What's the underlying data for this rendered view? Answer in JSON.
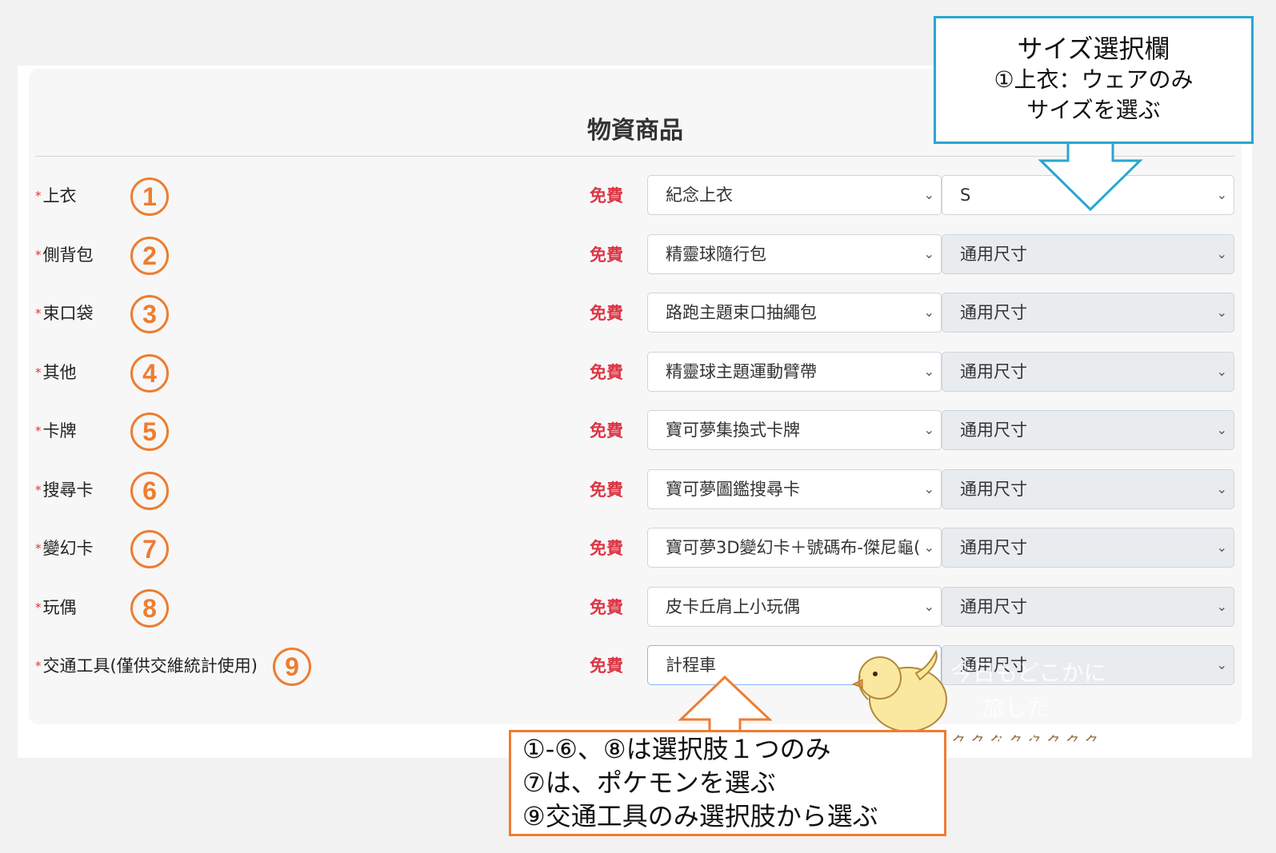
{
  "card": {
    "title": "物資商品"
  },
  "free_label": "免費",
  "rows": [
    {
      "label": "上衣",
      "number": "1",
      "item": "紀念上衣",
      "size": "S",
      "size_disabled": false
    },
    {
      "label": "側背包",
      "number": "2",
      "item": "精靈球隨行包",
      "size": "通用尺寸",
      "size_disabled": true
    },
    {
      "label": "束口袋",
      "number": "3",
      "item": "路跑主題束口抽繩包",
      "size": "通用尺寸",
      "size_disabled": true
    },
    {
      "label": "其他",
      "number": "4",
      "item": "精靈球主題運動臂帶",
      "size": "通用尺寸",
      "size_disabled": true
    },
    {
      "label": "卡牌",
      "number": "5",
      "item": "寶可夢集換式卡牌",
      "size": "通用尺寸",
      "size_disabled": true
    },
    {
      "label": "搜尋卡",
      "number": "6",
      "item": "寶可夢圖鑑搜尋卡",
      "size": "通用尺寸",
      "size_disabled": true
    },
    {
      "label": "變幻卡",
      "number": "7",
      "item": "寶可夢3D變幻卡＋號碼布-傑尼龜(",
      "size": "通用尺寸",
      "size_disabled": true
    },
    {
      "label": "玩偶",
      "number": "8",
      "item": "皮卡丘肩上小玩偶",
      "size": "通用尺寸",
      "size_disabled": true
    },
    {
      "label": "交通工具(僅供交維統計使用)",
      "number": "9",
      "item": "計程車",
      "size": "通用尺寸",
      "size_disabled": true
    }
  ],
  "required_mark": "*",
  "size_callout": {
    "line1": "サイズ選択欄",
    "line2": "①上衣：ウェアのみ",
    "line3": "サイズを選ぶ"
  },
  "note_callout": {
    "line1": "①-⑥、⑧は選択肢１つのみ",
    "line2": "⑦は、ポケモンを選ぶ",
    "line3": "⑨交通工具のみ選択肢から選ぶ"
  },
  "chick_text": {
    "line1": "今日もどこかに",
    "line2": "旅したい！！"
  },
  "colors": {
    "accent_orange": "#ed7d31",
    "accent_blue": "#2aa6d0",
    "free_red": "#dc3545"
  }
}
